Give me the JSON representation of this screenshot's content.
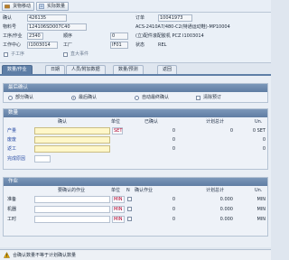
{
  "toolbar": {
    "btn1": "货物移动",
    "btn2": "实际数量"
  },
  "header": {
    "confirm_label": "确认",
    "confirm_value": "426135",
    "order_label": "订单",
    "order_value": "10041973",
    "material_label": "物料号",
    "material_value": "124106SD007C40",
    "material_desc": "ACS-2410A7/480-C2(特通运动鞋)-MP10004",
    "op_label": "工序/作业",
    "op_value": "2340",
    "seq_label": "顺序",
    "seq_value": "0",
    "op_desc": "(立)配件滚配胶机 PCZ I1003014",
    "wc_label": "工作中心",
    "wc_value": "I1003014",
    "plant_label": "工厂",
    "plant_value": "IF01",
    "status_label": "状态",
    "status_value": "REL",
    "chk1": "子工序",
    "chk2": "直大事件"
  },
  "tabs": [
    "数量/作业",
    "日期",
    "人员/附加数据",
    "数量/预测",
    "返回"
  ],
  "confirm_section": {
    "title": "最后确认",
    "opt1": "部分确认",
    "opt2": "最后确认",
    "opt3": "自动最终确认",
    "opt4": "清除预订"
  },
  "qty_section": {
    "title": "数量",
    "col_confirm": "确认",
    "col_unit": "单位",
    "col_confirmed": "已确认",
    "col_planned": "计划总计",
    "col_un": "Un.",
    "rows": [
      {
        "label": "产量",
        "unit": "SET",
        "confirmed": "0",
        "planned": "0",
        "un": "0 SET"
      },
      {
        "label": "废废",
        "unit": "",
        "confirmed": "0",
        "planned": "",
        "un": "0"
      },
      {
        "label": "返工",
        "unit": "",
        "confirmed": "0",
        "planned": "",
        "un": "0"
      },
      {
        "label": "完成原因",
        "unit": "",
        "confirmed": "",
        "planned": "",
        "un": ""
      }
    ]
  },
  "act_section": {
    "title": "作业",
    "col_confirm": "要确认的作业",
    "col_unit": "单位",
    "col_n": "N",
    "col_confirmed": "确认作业",
    "col_planned": "计划总计",
    "col_un": "Un.",
    "rows": [
      {
        "label": "准备",
        "unit": "MIN",
        "confirmed": "0",
        "planned": "0.000",
        "un": "MIN"
      },
      {
        "label": "机器",
        "unit": "MIN",
        "confirmed": "0",
        "planned": "0.000",
        "un": "MIN"
      },
      {
        "label": "工时",
        "unit": "MIN",
        "confirmed": "0",
        "planned": "0.000",
        "un": "MIN"
      }
    ]
  },
  "status_bar": {
    "message": "合确认数量不等于计划确认数量"
  },
  "colors": {
    "accent": "#5e7ea6",
    "unit_text": "#b2002a",
    "warn": "#e3a600"
  }
}
